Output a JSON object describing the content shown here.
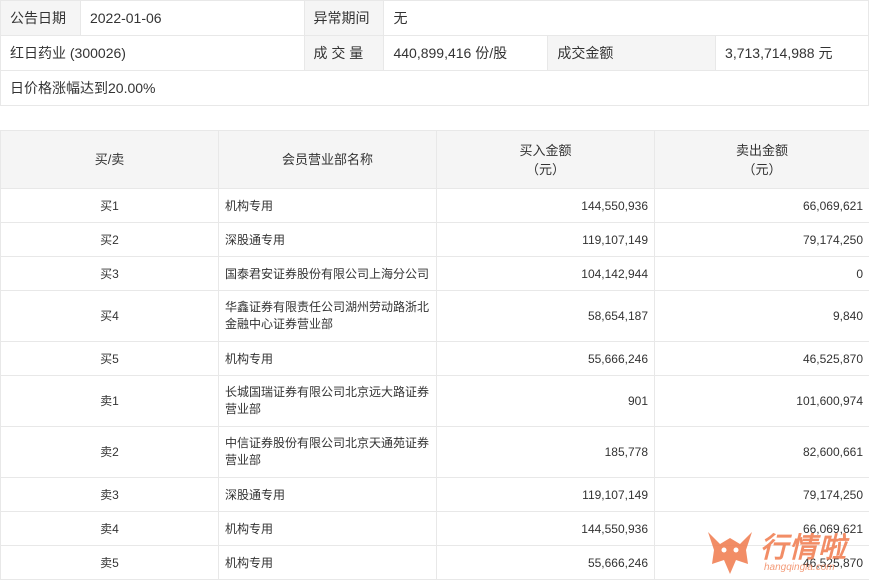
{
  "info": {
    "announce_date_label": "公告日期",
    "announce_date_value": "2022-01-06",
    "abnormal_period_label": "异常期间",
    "abnormal_period_value": "无",
    "stock_name": "红日药业 (300026)",
    "volume_label": "成 交 量",
    "volume_value": "440,899,416 份/股",
    "turnover_label": "成交金额",
    "turnover_value": "3,713,714,988 元",
    "reason": "日价格涨幅达到20.00%"
  },
  "table": {
    "headers": {
      "side": "买/卖",
      "broker": "会员营业部名称",
      "buy": "买入金额",
      "buy_unit": "（元）",
      "sell": "卖出金额",
      "sell_unit": "（元）"
    },
    "rows": [
      {
        "side": "买1",
        "broker": "机构专用",
        "buy": "144,550,936",
        "sell": "66,069,621"
      },
      {
        "side": "买2",
        "broker": "深股通专用",
        "buy": "119,107,149",
        "sell": "79,174,250"
      },
      {
        "side": "买3",
        "broker": "国泰君安证券股份有限公司上海分公司",
        "buy": "104,142,944",
        "sell": "0"
      },
      {
        "side": "买4",
        "broker": "华鑫证券有限责任公司湖州劳动路浙北金融中心证券营业部",
        "buy": "58,654,187",
        "sell": "9,840"
      },
      {
        "side": "买5",
        "broker": "机构专用",
        "buy": "55,666,246",
        "sell": "46,525,870"
      },
      {
        "side": "卖1",
        "broker": "长城国瑞证券有限公司北京远大路证券营业部",
        "buy": "901",
        "sell": "101,600,974"
      },
      {
        "side": "卖2",
        "broker": "中信证券股份有限公司北京天通苑证券营业部",
        "buy": "185,778",
        "sell": "82,600,661"
      },
      {
        "side": "卖3",
        "broker": "深股通专用",
        "buy": "119,107,149",
        "sell": "79,174,250"
      },
      {
        "side": "卖4",
        "broker": "机构专用",
        "buy": "144,550,936",
        "sell": "66,069,621"
      },
      {
        "side": "卖5",
        "broker": "机构专用",
        "buy": "55,666,246",
        "sell": "46,525,870"
      }
    ]
  },
  "watermark": {
    "brand": "行情啦",
    "domain": "hangqingla.com",
    "color": "#f07a4c"
  }
}
